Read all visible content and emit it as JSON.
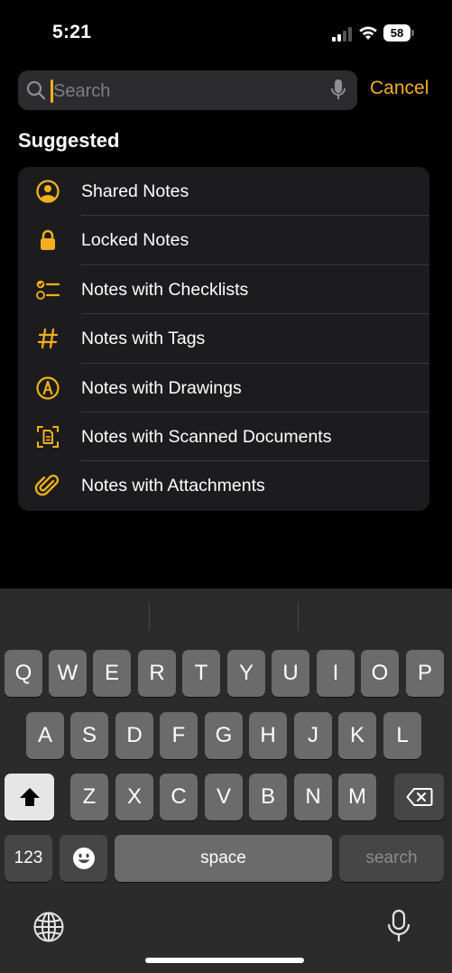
{
  "status_bar": {
    "time": "5:21",
    "battery": "58"
  },
  "search": {
    "placeholder": "Search",
    "cancel_label": "Cancel"
  },
  "suggested": {
    "title": "Suggested",
    "items": [
      {
        "label": "Shared Notes",
        "icon": "person-circle-icon"
      },
      {
        "label": "Locked Notes",
        "icon": "lock-icon"
      },
      {
        "label": "Notes with Checklists",
        "icon": "checklist-icon"
      },
      {
        "label": "Notes with Tags",
        "icon": "hashtag-icon"
      },
      {
        "label": "Notes with Drawings",
        "icon": "pencil-tip-circle-icon"
      },
      {
        "label": "Notes with Scanned Documents",
        "icon": "scanned-document-icon"
      },
      {
        "label": "Notes with Attachments",
        "icon": "paperclip-icon"
      }
    ]
  },
  "keyboard": {
    "row1": [
      "Q",
      "W",
      "E",
      "R",
      "T",
      "Y",
      "U",
      "I",
      "O",
      "P"
    ],
    "row2": [
      "A",
      "S",
      "D",
      "F",
      "G",
      "H",
      "J",
      "K",
      "L"
    ],
    "row3": [
      "Z",
      "X",
      "C",
      "V",
      "B",
      "N",
      "M"
    ],
    "numbers_label": "123",
    "space_label": "space",
    "search_label": "search"
  },
  "colors": {
    "accent": "#f2b01e",
    "background": "#000000",
    "list_background": "#1c1c1e",
    "key": "#6b6b6b"
  }
}
